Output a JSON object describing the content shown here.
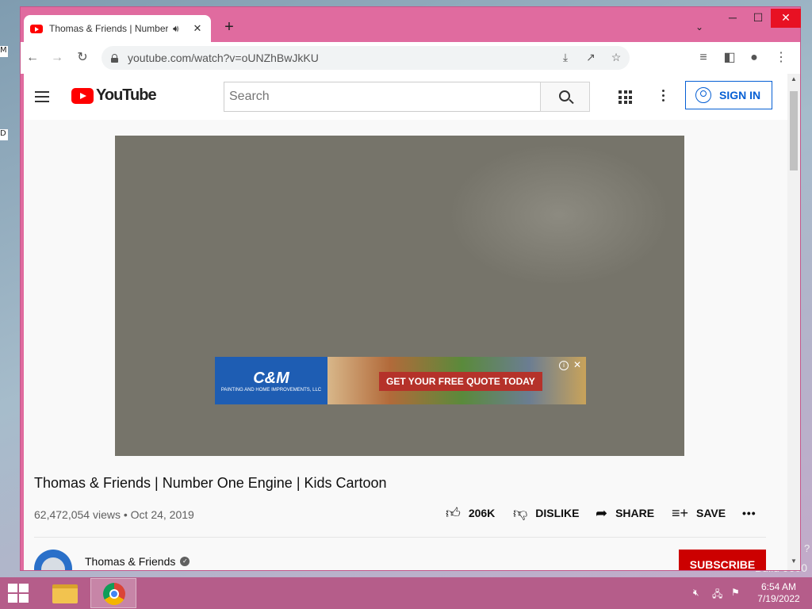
{
  "desktop": {
    "left_fragments": [
      "M",
      "D"
    ],
    "build_text": "Build 9600",
    "side_question": "?"
  },
  "browser": {
    "tab_title": "Thomas & Friends | Number",
    "new_tab": "+",
    "url": "youtube.com/watch?v=oUNZhBwJkKU",
    "window_controls": {
      "minimize": "─",
      "maximize": "☐",
      "close": "✕"
    }
  },
  "youtube": {
    "logo_text": "YouTube",
    "search_placeholder": "Search",
    "sign_in": "SIGN IN",
    "ad": {
      "brand": "C&M",
      "brand_sub": "PAINTING AND HOME IMPROVEMENTS, LLC",
      "cta": "GET YOUR FREE QUOTE TODAY"
    },
    "video": {
      "title": "Thomas & Friends | Number One Engine | Kids Cartoon",
      "meta": "62,472,054 views • Oct 24, 2019",
      "likes": "206K",
      "dislike_label": "DISLIKE",
      "share_label": "SHARE",
      "save_label": "SAVE",
      "more": "•••"
    },
    "channel": {
      "name": "Thomas & Friends",
      "subscribe": "SUBSCRIBE"
    }
  },
  "taskbar": {
    "clock_time": "6:54 AM",
    "clock_date": "7/19/2022"
  },
  "colors": {
    "window_frame": "#e06b9f",
    "taskbar": "#b55d8a",
    "youtube_red": "#ff0000",
    "link_blue": "#065fd4",
    "subscribe_red": "#cc0000"
  }
}
